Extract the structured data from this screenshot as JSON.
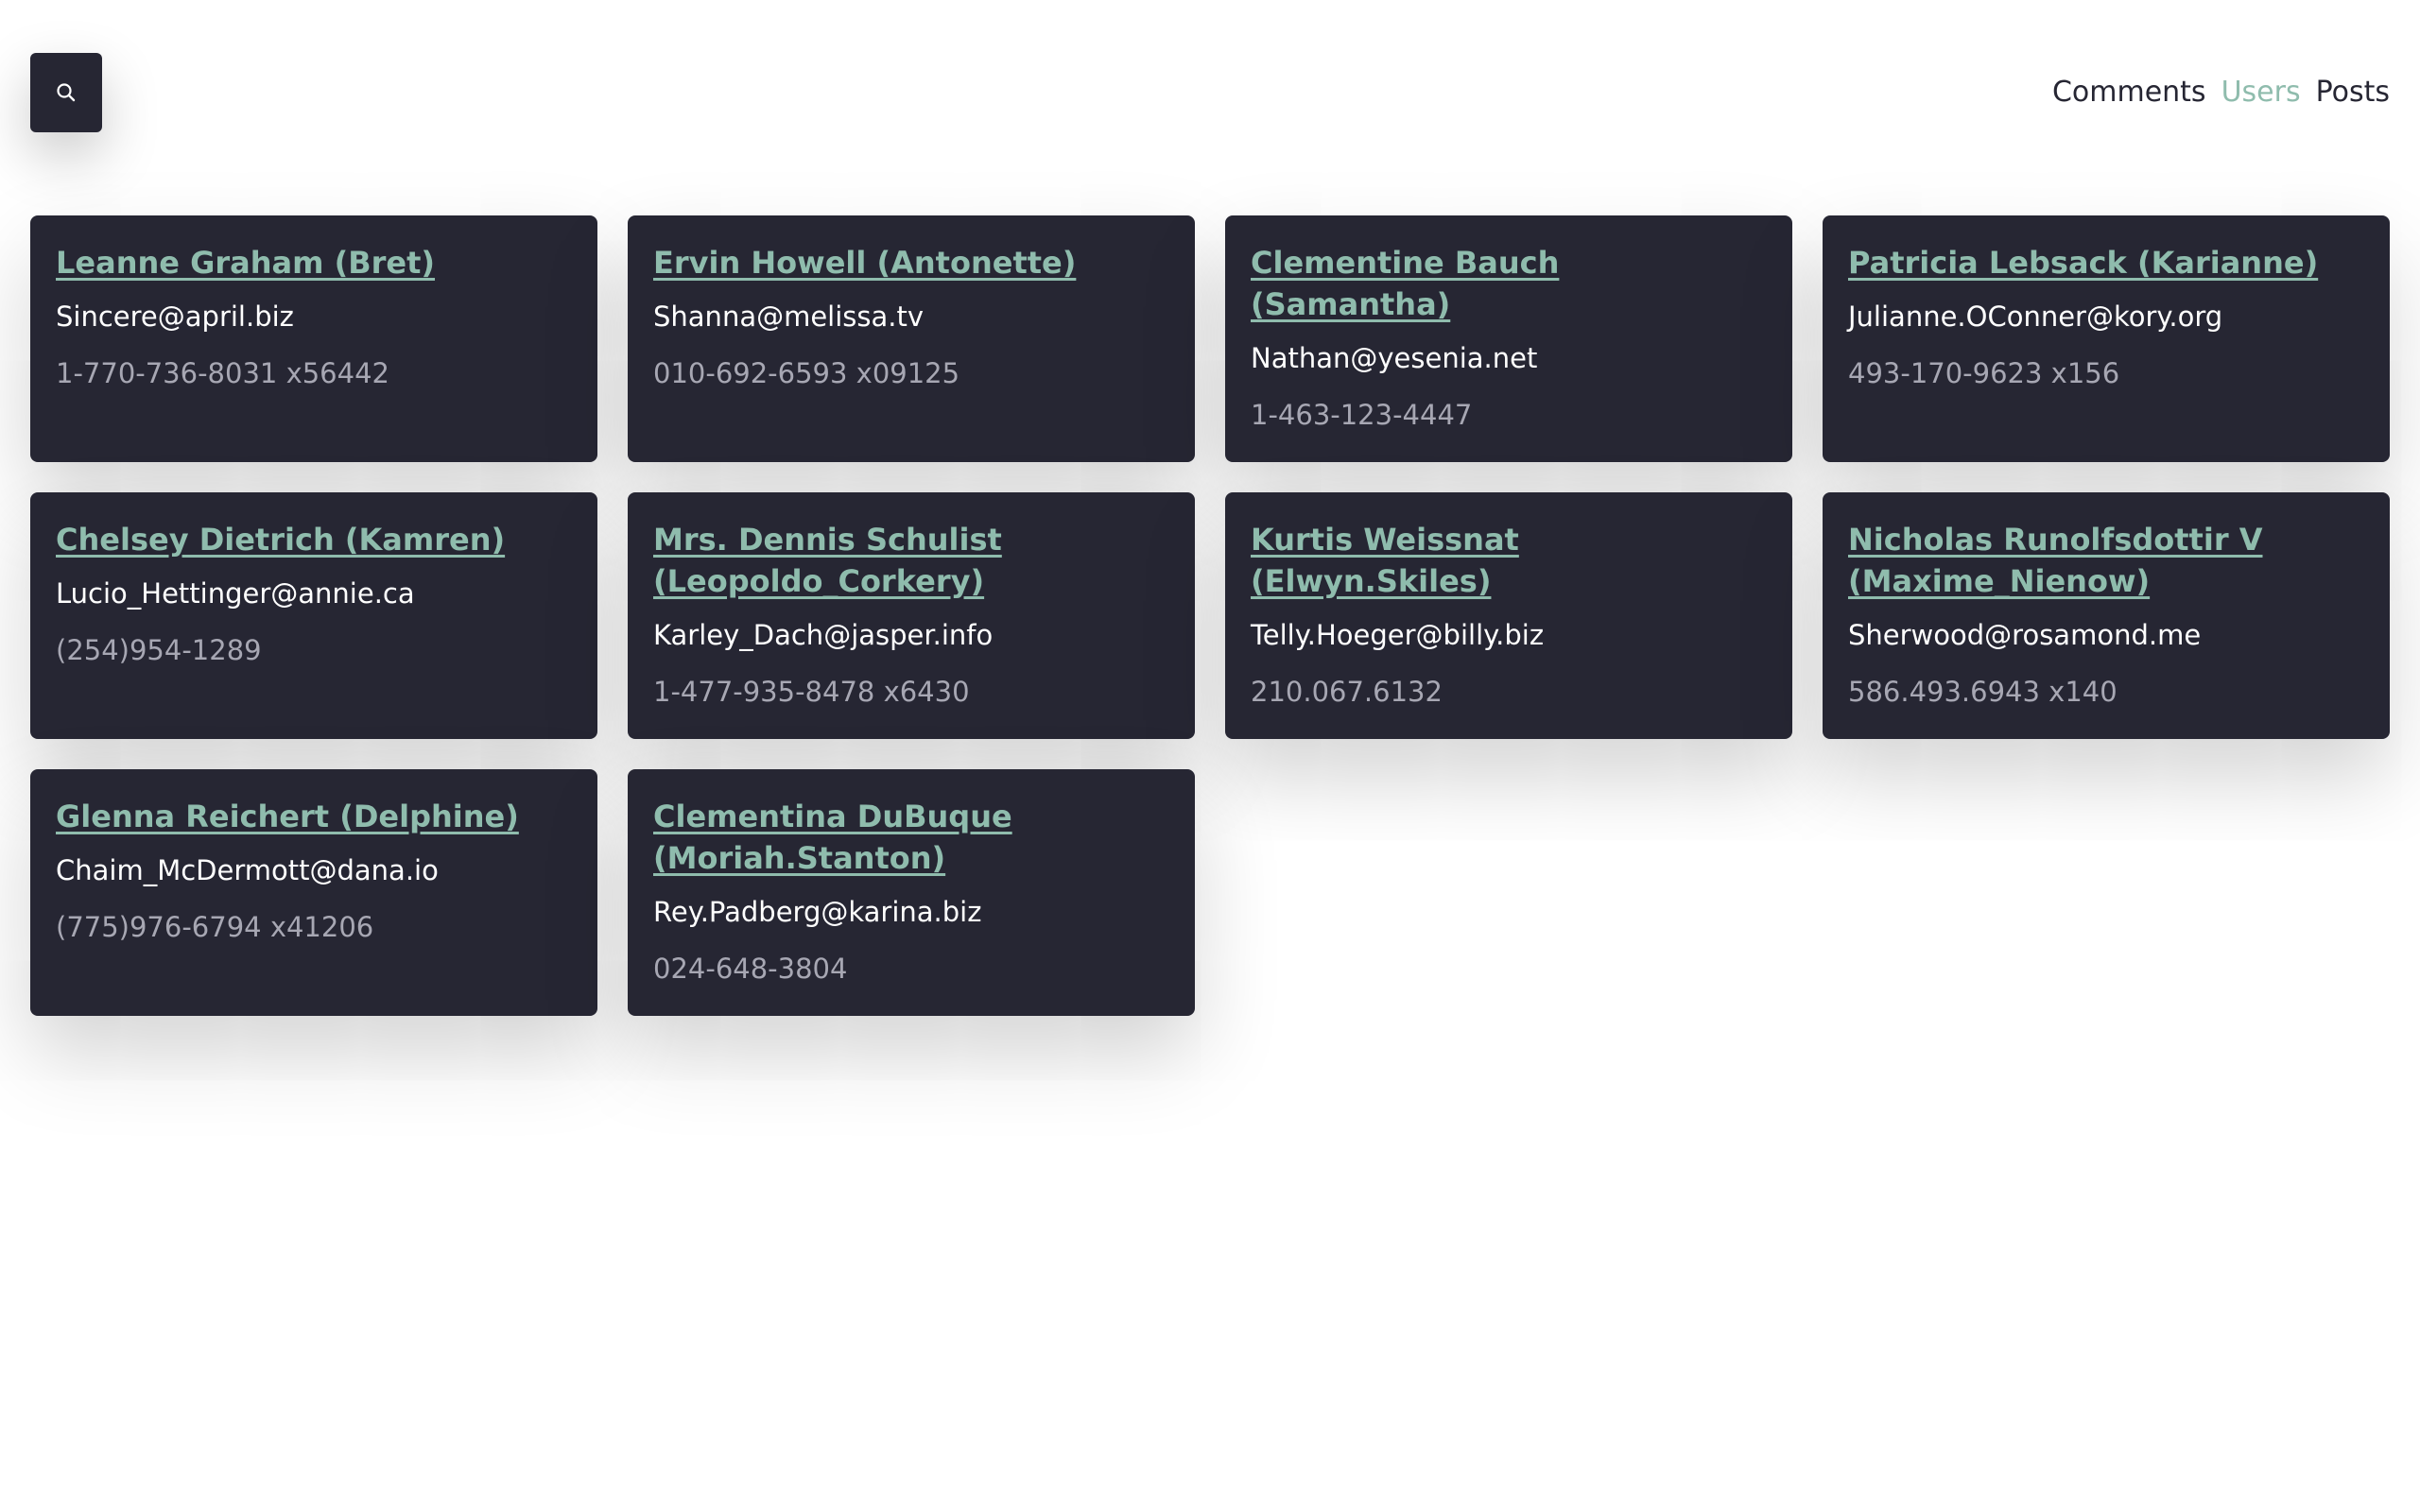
{
  "search": {
    "icon": "search-icon"
  },
  "nav": {
    "items": [
      {
        "label": "Comments",
        "active": false
      },
      {
        "label": "Users",
        "active": true
      },
      {
        "label": "Posts",
        "active": false
      }
    ],
    "active_color": "#8fbcad"
  },
  "colors": {
    "card_bg": "#262633",
    "accent": "#8fbcad",
    "phone": "#a7a7b3"
  },
  "users": [
    {
      "name": "Leanne Graham (Bret)",
      "email": "Sincere@april.biz",
      "phone": "1-770-736-8031 x56442"
    },
    {
      "name": "Ervin Howell (Antonette)",
      "email": "Shanna@melissa.tv",
      "phone": "010-692-6593 x09125"
    },
    {
      "name": "Clementine Bauch (Samantha)",
      "email": "Nathan@yesenia.net",
      "phone": "1-463-123-4447"
    },
    {
      "name": "Patricia Lebsack (Karianne)",
      "email": "Julianne.OConner@kory.org",
      "phone": "493-170-9623 x156"
    },
    {
      "name": "Chelsey Dietrich (Kamren)",
      "email": "Lucio_Hettinger@annie.ca",
      "phone": "(254)954-1289"
    },
    {
      "name": "Mrs. Dennis Schulist (Leopoldo_Corkery)",
      "email": "Karley_Dach@jasper.info",
      "phone": "1-477-935-8478 x6430"
    },
    {
      "name": "Kurtis Weissnat (Elwyn.Skiles)",
      "email": "Telly.Hoeger@billy.biz",
      "phone": "210.067.6132"
    },
    {
      "name": "Nicholas Runolfsdottir V (Maxime_Nienow)",
      "email": "Sherwood@rosamond.me",
      "phone": "586.493.6943 x140"
    },
    {
      "name": "Glenna Reichert (Delphine)",
      "email": "Chaim_McDermott@dana.io",
      "phone": "(775)976-6794 x41206"
    },
    {
      "name": "Clementina DuBuque (Moriah.Stanton)",
      "email": "Rey.Padberg@karina.biz",
      "phone": "024-648-3804"
    }
  ]
}
